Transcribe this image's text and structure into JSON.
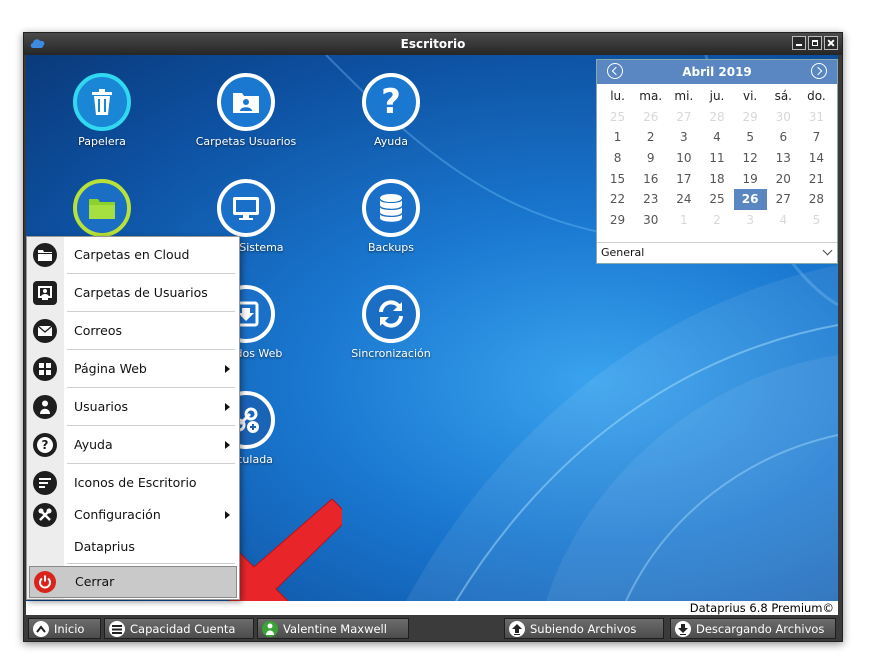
{
  "window": {
    "title": "Escritorio"
  },
  "desktop": {
    "icons": [
      {
        "label": "Papelera",
        "icon": "trash-icon"
      },
      {
        "label": "Carpetas Usuarios",
        "icon": "user-folder-icon"
      },
      {
        "label": "Ayuda",
        "icon": "question-icon"
      },
      {
        "label": "",
        "icon": "folder-icon"
      },
      {
        "label": "b del Sistema",
        "icon": "monitor-icon"
      },
      {
        "label": "Backups",
        "icon": "database-icon"
      },
      {
        "label": "ecibidos Web",
        "icon": "inbox-download-icon"
      },
      {
        "label": "Sincronización",
        "icon": "sync-icon"
      },
      {
        "label": "Vinculada",
        "icon": "link-add-icon"
      }
    ]
  },
  "calendar": {
    "month_label": "Abril 2019",
    "weekdays": [
      "lu.",
      "ma.",
      "mi.",
      "ju.",
      "vi.",
      "sá.",
      "do."
    ],
    "days": [
      "25",
      "26",
      "27",
      "28",
      "29",
      "30",
      "31",
      "1",
      "2",
      "3",
      "4",
      "5",
      "6",
      "7",
      "8",
      "9",
      "10",
      "11",
      "12",
      "13",
      "14",
      "15",
      "16",
      "17",
      "18",
      "19",
      "20",
      "21",
      "22",
      "23",
      "24",
      "25",
      "26",
      "27",
      "28",
      "29",
      "30",
      "1",
      "2",
      "3",
      "4",
      "5"
    ],
    "selected_day": "26",
    "dropdown_value": "General"
  },
  "start_menu": {
    "items": [
      {
        "label": "Carpetas en Cloud",
        "icon": "cloud-folder-icon",
        "submenu": false
      },
      {
        "label": "Carpetas de Usuarios",
        "icon": "user-folders-icon",
        "submenu": false
      },
      {
        "label": "Correos",
        "icon": "mail-icon",
        "submenu": false
      },
      {
        "label": "Página Web",
        "icon": "web-grid-icon",
        "submenu": true
      },
      {
        "label": "Usuarios",
        "icon": "user-icon",
        "submenu": true
      },
      {
        "label": "Ayuda",
        "icon": "help-icon",
        "submenu": true
      },
      {
        "label": "Iconos de Escritorio",
        "icon": "desktop-icons-icon",
        "submenu": false
      },
      {
        "label": "Configuración",
        "icon": "tools-icon",
        "submenu": true
      },
      {
        "label": "Dataprius",
        "icon": "",
        "submenu": false
      },
      {
        "label": "Cerrar",
        "icon": "power-icon",
        "submenu": false
      }
    ]
  },
  "status": {
    "version": "Dataprius 6.8 Premium©"
  },
  "taskbar": {
    "start_label": "Inicio",
    "capacity_label": "Capacidad Cuenta",
    "user_label": "Valentine Maxwell",
    "upload_label": "Subiendo Archivos",
    "download_label": "Descargando Archivos"
  },
  "colors": {
    "accent": "#5a86c2",
    "arrow": "#e8262a",
    "power": "#d9241c",
    "papelera_ring": "#30d8f0",
    "folder_ring": "#b8e23a"
  }
}
